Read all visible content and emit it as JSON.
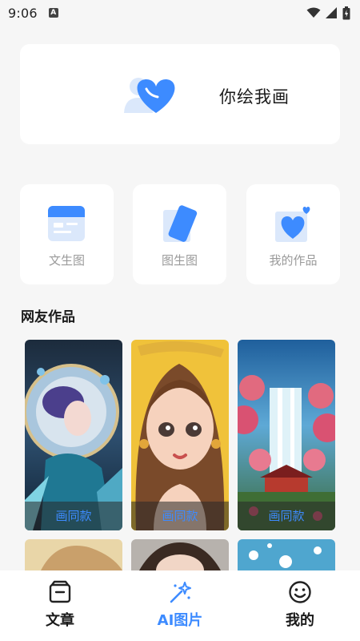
{
  "status_bar": {
    "time": "9:06",
    "a_badge": "A"
  },
  "hero": {
    "title": "你绘我画",
    "icon": "heart-person-icon"
  },
  "features": [
    {
      "label": "文生图",
      "icon": "text-to-image-icon"
    },
    {
      "label": "图生图",
      "icon": "image-to-image-icon"
    },
    {
      "label": "我的作品",
      "icon": "my-works-heart-icon"
    }
  ],
  "section": {
    "title": "网友作品"
  },
  "gallery": [
    {
      "button": "画同款",
      "subject": "fantasy-woman-portrait"
    },
    {
      "button": "画同款",
      "subject": "cartoon-girl-portrait"
    },
    {
      "button": "画同款",
      "subject": "waterfall-landscape"
    }
  ],
  "bottom_nav": [
    {
      "label": "文章",
      "icon": "article-box-icon",
      "active": false
    },
    {
      "label": "AI图片",
      "icon": "magic-wand-icon",
      "active": true
    },
    {
      "label": "我的",
      "icon": "smiley-face-icon",
      "active": false
    }
  ],
  "colors": {
    "accent": "#3d8bff",
    "background": "#f6f6f6",
    "card": "#ffffff",
    "muted_text": "#9a9a9a"
  }
}
